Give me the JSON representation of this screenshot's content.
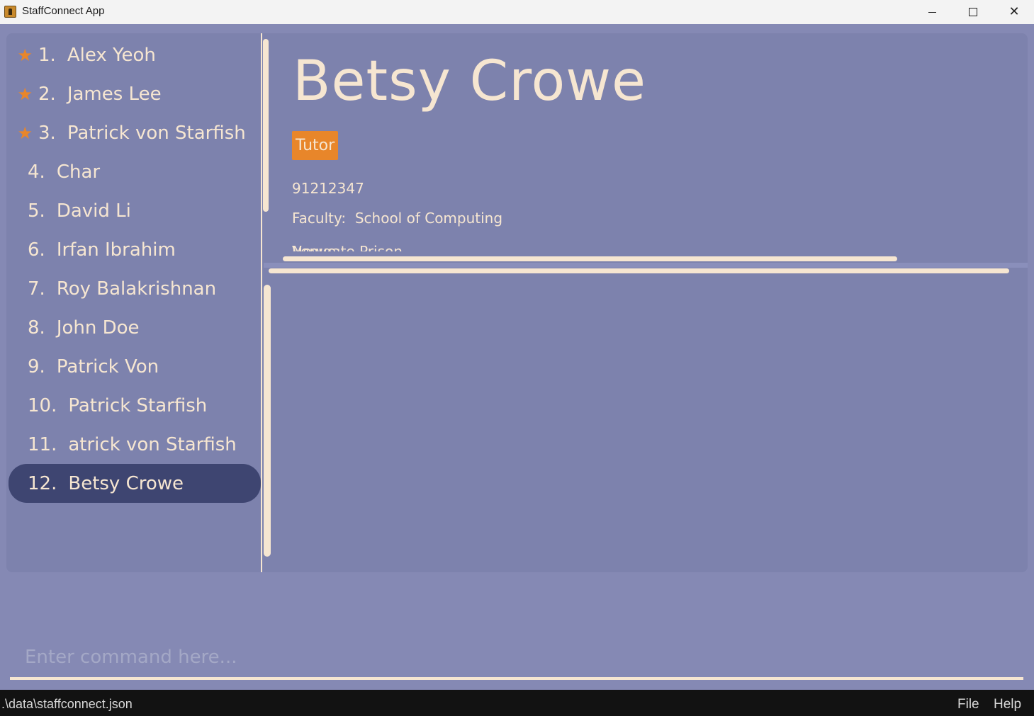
{
  "window": {
    "title": "StaffConnect App",
    "app_icon": "app-icon",
    "minimize_icon": "minimize-icon",
    "maximize_icon": "maximize-icon",
    "close_icon": "close-icon",
    "close_glyph": "✕"
  },
  "colors": {
    "background": "#8589b4",
    "panel": "#7d82ad",
    "text": "#f6e6d1",
    "accent": "#e8862a",
    "selected": "#3e4571",
    "statusbar": "#121212"
  },
  "person_list": [
    {
      "index": "1.",
      "name": "Alex Yeoh",
      "favourite": true
    },
    {
      "index": "2.",
      "name": "James Lee",
      "favourite": true
    },
    {
      "index": "3.",
      "name": "Patrick von Starfish",
      "favourite": true
    },
    {
      "index": "4.",
      "name": "Char",
      "favourite": false
    },
    {
      "index": "5.",
      "name": "David Li",
      "favourite": false
    },
    {
      "index": "6.",
      "name": "Irfan Ibrahim",
      "favourite": false
    },
    {
      "index": "7.",
      "name": "Roy Balakrishnan",
      "favourite": false
    },
    {
      "index": "8.",
      "name": "John Doe",
      "favourite": false
    },
    {
      "index": "9.",
      "name": "Patrick Von",
      "favourite": false
    },
    {
      "index": "10.",
      "name": "Patrick Starfish",
      "favourite": false
    },
    {
      "index": "11.",
      "name": "atrick von Starfish",
      "favourite": false
    },
    {
      "index": "12.",
      "name": "Betsy Crowe",
      "favourite": false,
      "selected": true
    }
  ],
  "star_glyph": "★",
  "detail": {
    "name": "Betsy Crowe",
    "tag": "Tutor",
    "phone": "91212347",
    "faculty_label": "Faculty:",
    "faculty": "School of Computing",
    "venue_label": "Venue:",
    "venue": "Newgate Prison"
  },
  "command": {
    "placeholder": "Enter command here...",
    "value": ""
  },
  "status": {
    "file_path": ".\\data\\staffconnect.json"
  },
  "menu": {
    "file": "File",
    "help": "Help"
  }
}
